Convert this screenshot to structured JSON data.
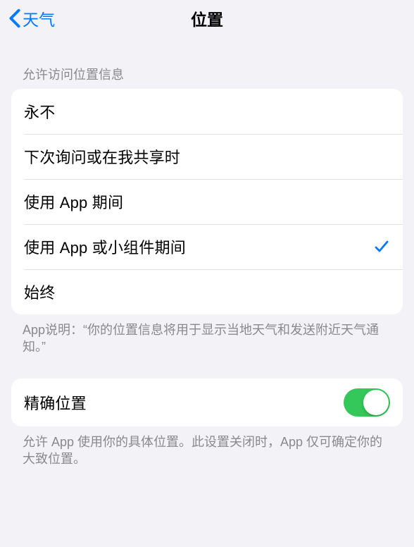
{
  "nav": {
    "back_label": "天气",
    "title": "位置"
  },
  "access_section": {
    "header": "允许访问位置信息",
    "options": {
      "never": "永不",
      "ask": "下次询问或在我共享时",
      "while_using": "使用 App 期间",
      "while_using_widgets": "使用 App 或小组件期间",
      "always": "始终"
    },
    "selected": "while_using_widgets",
    "footer": "App说明：“你的位置信息将用于显示当地天气和发送附近天气通知。”"
  },
  "precise_section": {
    "label": "精确位置",
    "footer": "允许 App 使用你的具体位置。此设置关闭时，App 仅可确定你的大致位置。",
    "enabled": true
  },
  "colors": {
    "accent": "#007aff",
    "switch_on": "#34c759"
  }
}
